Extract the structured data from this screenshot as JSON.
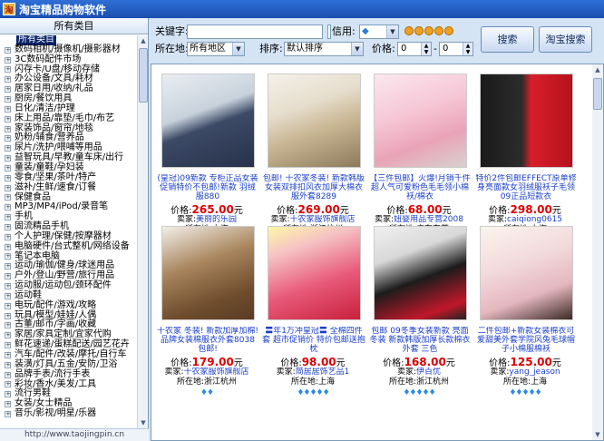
{
  "window": {
    "title": "淘宝精品购物软件",
    "icon": "app-logo-icon"
  },
  "sidebar": {
    "header": "所有类目",
    "footer": "http://www.taojingpin.cn",
    "items": [
      "所有类目",
      "数码相机/摄像机/摄影器材",
      "3C数码配件市场",
      "闪存卡/U盘/移动存储",
      "办公设备/文具/耗材",
      "居家日用/收纳/礼品",
      "厨房/餐饮用具",
      "日化/清洁/护理",
      "床上用品/靠垫/毛巾/布艺",
      "家装饰品/窗帘/地毯",
      "奶粉/辅食/营养品",
      "尿片/洗护/喂哺等用品",
      "益智玩具/早教/童车床/出行",
      "童装/童鞋/孕妇装",
      "零食/坚果/茶叶/特产",
      "滋补/生鲜/速食/订餐",
      "保健食品",
      "MP3/MP4/iPod/录音笔",
      "手机",
      "固流精品手机",
      "个人护理/保健/按摩器材",
      "电脑硬件/台式整机/网络设备",
      "笔记本电脑",
      "运动/瑜伽/健身/球迷用品",
      "户外/登山/野营/旅行用品",
      "运动服/运动包/颈环配件",
      "运动鞋",
      "电玩/配件/游戏/攻略",
      "玩具/模型/娃娃/人偶",
      "古董/邮币/字画/收藏",
      "家居/家具定制/宜家代购",
      "鲜花速递/蛋糕配送/园艺花卉",
      "汽车/配件/改装/摩托/自行车",
      "装潢/灯具/五金/安防/卫浴",
      "品牌手表/流行手表",
      "彩妆/香水/美发/工具",
      "流行男鞋",
      "女装/女士精品",
      "音乐/影视/明星/乐器"
    ]
  },
  "filters": {
    "keyword_label": "关键字:",
    "keyword_value": "",
    "credit_label": "信用:",
    "credit_value": "◆",
    "location_label": "所在地:",
    "location_value": "所有地区",
    "sort_label": "排序:",
    "sort_value": "默认排序",
    "price_label": "价格:",
    "price_min": "0",
    "price_sep": "-",
    "price_max": "0",
    "search_button": "搜索",
    "taobao_search_button": "淘宝搜索"
  },
  "products": [
    {
      "title": "(皇冠)09新款 专柜正品女装 促销特价不包邮!新款 羽绒服880",
      "price_label": "价格:",
      "price": "265.00",
      "price_unit": "元",
      "seller_label": "卖家:",
      "seller": "美丽的乐园",
      "loc_label": "所在地:",
      "location": "上海",
      "rating": "♦♦"
    },
    {
      "title": "包邮! 十农家冬装! 新款韩版女装双排扣风衣加厚大棉衣服外套8289",
      "price_label": "价格:",
      "price": "269.00",
      "price_unit": "元",
      "seller_label": "卖家:",
      "seller": "十农家服饰旗舰店",
      "loc_label": "所在地:",
      "location": "浙江杭州",
      "rating": "♦♦"
    },
    {
      "title": "【三件包邮】火爆!月销千件 超人气可爱粉色毛毛领小棉袄/棉衣",
      "price_label": "价格:",
      "price": "68.00",
      "price_unit": "元",
      "seller_label": "卖家:",
      "seller": "妞婴用品专营2008",
      "loc_label": "所在地:",
      "location": "广东东莞",
      "rating": "♦♦♦♦♦"
    },
    {
      "title": "特价2件包邮EFFECT原单修身亮面款女羽绒服袄子毛领09正品短款衣",
      "price_label": "价格:",
      "price": "298.00",
      "price_unit": "元",
      "seller_label": "卖家:",
      "seller": "caiqiong0615",
      "loc_label": "所在地:",
      "location": "上海",
      "rating": "♦♦♦"
    },
    {
      "title": "十农家 冬装! 新款加厚加棉! 品牌女装棉服衣外套8038 包邮!",
      "price_label": "价格:",
      "price": "179.00",
      "price_unit": "元",
      "seller_label": "卖家:",
      "seller": "十农家服饰旗舰店",
      "loc_label": "所在地:",
      "location": "浙江杭州",
      "rating": "♦♦"
    },
    {
      "title": "〓年1万冲皇冠〓 全棉四件套 超市促销价 特价包邮送抱枕",
      "price_label": "价格:",
      "price": "98.00",
      "price_unit": "元",
      "seller_label": "卖家:",
      "seller": "简居居饰艺品1",
      "loc_label": "所在地:",
      "location": "上海",
      "rating": "♦♦♦♦♦"
    },
    {
      "title": "包邮 09冬季女装新款 亮面冬装 新款韩版加厚长款棉衣外套 三色",
      "price_label": "价格:",
      "price": "168.00",
      "price_unit": "元",
      "seller_label": "卖家:",
      "seller": "伊百优",
      "loc_label": "所在地:",
      "location": "浙江杭州",
      "rating": "♦♦♦♦♦"
    },
    {
      "title": "二件包邮+新款女装棉衣可爱甜美外套学院风兔毛球帽子小棉服棉袄",
      "price_label": "价格:",
      "price": "125.00",
      "price_unit": "元",
      "seller_label": "卖家:",
      "seller": "yang_jeason",
      "loc_label": "所在地:",
      "location": "上海",
      "rating": "♦♦♦♦♦"
    }
  ],
  "colors": {
    "accent": "#1b4fb0",
    "price": "#dd0000",
    "link": "#1a3ec8",
    "diamond": "#2b8be6"
  }
}
